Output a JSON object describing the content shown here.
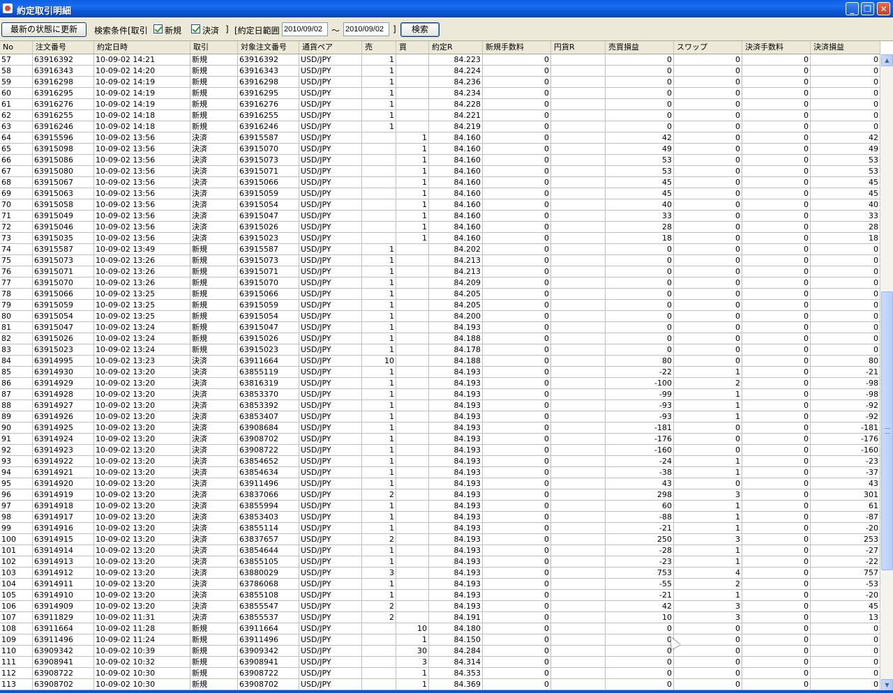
{
  "window": {
    "title": "約定取引明細",
    "min_glyph": "_",
    "max_glyph": "❐",
    "close_glyph": "✕"
  },
  "toolbar": {
    "refresh_label": "最新の状態に更新",
    "condition_label": "検索条件[取引",
    "new_label": "新規",
    "settle_label": "決済",
    "bracket_close": "]",
    "date_range_label": "[約定日範囲",
    "date_from": "2010/09/02",
    "tilde": "～",
    "date_to": "2010/09/02",
    "bracket_close2": "]",
    "search_label": "検索"
  },
  "columns": [
    "No",
    "注文番号",
    "約定日時",
    "取引",
    "対象注文番号",
    "通貨ペア",
    "売",
    "買",
    "約定R",
    "新規手数料",
    "円貨R",
    "売買損益",
    "スワップ",
    "決済手数料",
    "決済損益"
  ],
  "rows": [
    [
      "57",
      "63916392",
      "10-09-02 14:21",
      "新規",
      "63916392",
      "USD/JPY",
      "1",
      "",
      "84.223",
      "0",
      "",
      "0",
      "0",
      "0",
      "0"
    ],
    [
      "58",
      "63916343",
      "10-09-02 14:20",
      "新規",
      "63916343",
      "USD/JPY",
      "1",
      "",
      "84.224",
      "0",
      "",
      "0",
      "0",
      "0",
      "0"
    ],
    [
      "59",
      "63916298",
      "10-09-02 14:19",
      "新規",
      "63916298",
      "USD/JPY",
      "1",
      "",
      "84.236",
      "0",
      "",
      "0",
      "0",
      "0",
      "0"
    ],
    [
      "60",
      "63916295",
      "10-09-02 14:19",
      "新規",
      "63916295",
      "USD/JPY",
      "1",
      "",
      "84.234",
      "0",
      "",
      "0",
      "0",
      "0",
      "0"
    ],
    [
      "61",
      "63916276",
      "10-09-02 14:19",
      "新規",
      "63916276",
      "USD/JPY",
      "1",
      "",
      "84.228",
      "0",
      "",
      "0",
      "0",
      "0",
      "0"
    ],
    [
      "62",
      "63916255",
      "10-09-02 14:18",
      "新規",
      "63916255",
      "USD/JPY",
      "1",
      "",
      "84.221",
      "0",
      "",
      "0",
      "0",
      "0",
      "0"
    ],
    [
      "63",
      "63916246",
      "10-09-02 14:18",
      "新規",
      "63916246",
      "USD/JPY",
      "1",
      "",
      "84.219",
      "0",
      "",
      "0",
      "0",
      "0",
      "0"
    ],
    [
      "64",
      "63915596",
      "10-09-02 13:56",
      "決済",
      "63915587",
      "USD/JPY",
      "",
      "1",
      "84.160",
      "0",
      "",
      "42",
      "0",
      "0",
      "42"
    ],
    [
      "65",
      "63915098",
      "10-09-02 13:56",
      "決済",
      "63915070",
      "USD/JPY",
      "",
      "1",
      "84.160",
      "0",
      "",
      "49",
      "0",
      "0",
      "49"
    ],
    [
      "66",
      "63915086",
      "10-09-02 13:56",
      "決済",
      "63915073",
      "USD/JPY",
      "",
      "1",
      "84.160",
      "0",
      "",
      "53",
      "0",
      "0",
      "53"
    ],
    [
      "67",
      "63915080",
      "10-09-02 13:56",
      "決済",
      "63915071",
      "USD/JPY",
      "",
      "1",
      "84.160",
      "0",
      "",
      "53",
      "0",
      "0",
      "53"
    ],
    [
      "68",
      "63915067",
      "10-09-02 13:56",
      "決済",
      "63915066",
      "USD/JPY",
      "",
      "1",
      "84.160",
      "0",
      "",
      "45",
      "0",
      "0",
      "45"
    ],
    [
      "69",
      "63915063",
      "10-09-02 13:56",
      "決済",
      "63915059",
      "USD/JPY",
      "",
      "1",
      "84.160",
      "0",
      "",
      "45",
      "0",
      "0",
      "45"
    ],
    [
      "70",
      "63915058",
      "10-09-02 13:56",
      "決済",
      "63915054",
      "USD/JPY",
      "",
      "1",
      "84.160",
      "0",
      "",
      "40",
      "0",
      "0",
      "40"
    ],
    [
      "71",
      "63915049",
      "10-09-02 13:56",
      "決済",
      "63915047",
      "USD/JPY",
      "",
      "1",
      "84.160",
      "0",
      "",
      "33",
      "0",
      "0",
      "33"
    ],
    [
      "72",
      "63915046",
      "10-09-02 13:56",
      "決済",
      "63915026",
      "USD/JPY",
      "",
      "1",
      "84.160",
      "0",
      "",
      "28",
      "0",
      "0",
      "28"
    ],
    [
      "73",
      "63915035",
      "10-09-02 13:56",
      "決済",
      "63915023",
      "USD/JPY",
      "",
      "1",
      "84.160",
      "0",
      "",
      "18",
      "0",
      "0",
      "18"
    ],
    [
      "74",
      "63915587",
      "10-09-02 13:49",
      "新規",
      "63915587",
      "USD/JPY",
      "1",
      "",
      "84.202",
      "0",
      "",
      "0",
      "0",
      "0",
      "0"
    ],
    [
      "75",
      "63915073",
      "10-09-02 13:26",
      "新規",
      "63915073",
      "USD/JPY",
      "1",
      "",
      "84.213",
      "0",
      "",
      "0",
      "0",
      "0",
      "0"
    ],
    [
      "76",
      "63915071",
      "10-09-02 13:26",
      "新規",
      "63915071",
      "USD/JPY",
      "1",
      "",
      "84.213",
      "0",
      "",
      "0",
      "0",
      "0",
      "0"
    ],
    [
      "77",
      "63915070",
      "10-09-02 13:26",
      "新規",
      "63915070",
      "USD/JPY",
      "1",
      "",
      "84.209",
      "0",
      "",
      "0",
      "0",
      "0",
      "0"
    ],
    [
      "78",
      "63915066",
      "10-09-02 13:25",
      "新規",
      "63915066",
      "USD/JPY",
      "1",
      "",
      "84.205",
      "0",
      "",
      "0",
      "0",
      "0",
      "0"
    ],
    [
      "79",
      "63915059",
      "10-09-02 13:25",
      "新規",
      "63915059",
      "USD/JPY",
      "1",
      "",
      "84.205",
      "0",
      "",
      "0",
      "0",
      "0",
      "0"
    ],
    [
      "80",
      "63915054",
      "10-09-02 13:25",
      "新規",
      "63915054",
      "USD/JPY",
      "1",
      "",
      "84.200",
      "0",
      "",
      "0",
      "0",
      "0",
      "0"
    ],
    [
      "81",
      "63915047",
      "10-09-02 13:24",
      "新規",
      "63915047",
      "USD/JPY",
      "1",
      "",
      "84.193",
      "0",
      "",
      "0",
      "0",
      "0",
      "0"
    ],
    [
      "82",
      "63915026",
      "10-09-02 13:24",
      "新規",
      "63915026",
      "USD/JPY",
      "1",
      "",
      "84.188",
      "0",
      "",
      "0",
      "0",
      "0",
      "0"
    ],
    [
      "83",
      "63915023",
      "10-09-02 13:24",
      "新規",
      "63915023",
      "USD/JPY",
      "1",
      "",
      "84.178",
      "0",
      "",
      "0",
      "0",
      "0",
      "0"
    ],
    [
      "84",
      "63914995",
      "10-09-02 13:23",
      "決済",
      "63911664",
      "USD/JPY",
      "10",
      "",
      "84.188",
      "0",
      "",
      "80",
      "0",
      "0",
      "80"
    ],
    [
      "85",
      "63914930",
      "10-09-02 13:20",
      "決済",
      "63855119",
      "USD/JPY",
      "1",
      "",
      "84.193",
      "0",
      "",
      "-22",
      "1",
      "0",
      "-21"
    ],
    [
      "86",
      "63914929",
      "10-09-02 13:20",
      "決済",
      "63816319",
      "USD/JPY",
      "1",
      "",
      "84.193",
      "0",
      "",
      "-100",
      "2",
      "0",
      "-98"
    ],
    [
      "87",
      "63914928",
      "10-09-02 13:20",
      "決済",
      "63853370",
      "USD/JPY",
      "1",
      "",
      "84.193",
      "0",
      "",
      "-99",
      "1",
      "0",
      "-98"
    ],
    [
      "88",
      "63914927",
      "10-09-02 13:20",
      "決済",
      "63853392",
      "USD/JPY",
      "1",
      "",
      "84.193",
      "0",
      "",
      "-93",
      "1",
      "0",
      "-92"
    ],
    [
      "89",
      "63914926",
      "10-09-02 13:20",
      "決済",
      "63853407",
      "USD/JPY",
      "1",
      "",
      "84.193",
      "0",
      "",
      "-93",
      "1",
      "0",
      "-92"
    ],
    [
      "90",
      "63914925",
      "10-09-02 13:20",
      "決済",
      "63908684",
      "USD/JPY",
      "1",
      "",
      "84.193",
      "0",
      "",
      "-181",
      "0",
      "0",
      "-181"
    ],
    [
      "91",
      "63914924",
      "10-09-02 13:20",
      "決済",
      "63908702",
      "USD/JPY",
      "1",
      "",
      "84.193",
      "0",
      "",
      "-176",
      "0",
      "0",
      "-176"
    ],
    [
      "92",
      "63914923",
      "10-09-02 13:20",
      "決済",
      "63908722",
      "USD/JPY",
      "1",
      "",
      "84.193",
      "0",
      "",
      "-160",
      "0",
      "0",
      "-160"
    ],
    [
      "93",
      "63914922",
      "10-09-02 13:20",
      "決済",
      "63854652",
      "USD/JPY",
      "1",
      "",
      "84.193",
      "0",
      "",
      "-24",
      "1",
      "0",
      "-23"
    ],
    [
      "94",
      "63914921",
      "10-09-02 13:20",
      "決済",
      "63854634",
      "USD/JPY",
      "1",
      "",
      "84.193",
      "0",
      "",
      "-38",
      "1",
      "0",
      "-37"
    ],
    [
      "95",
      "63914920",
      "10-09-02 13:20",
      "決済",
      "63911496",
      "USD/JPY",
      "1",
      "",
      "84.193",
      "0",
      "",
      "43",
      "0",
      "0",
      "43"
    ],
    [
      "96",
      "63914919",
      "10-09-02 13:20",
      "決済",
      "63837066",
      "USD/JPY",
      "2",
      "",
      "84.193",
      "0",
      "",
      "298",
      "3",
      "0",
      "301"
    ],
    [
      "97",
      "63914918",
      "10-09-02 13:20",
      "決済",
      "63855994",
      "USD/JPY",
      "1",
      "",
      "84.193",
      "0",
      "",
      "60",
      "1",
      "0",
      "61"
    ],
    [
      "98",
      "63914917",
      "10-09-02 13:20",
      "決済",
      "63853403",
      "USD/JPY",
      "1",
      "",
      "84.193",
      "0",
      "",
      "-88",
      "1",
      "0",
      "-87"
    ],
    [
      "99",
      "63914916",
      "10-09-02 13:20",
      "決済",
      "63855114",
      "USD/JPY",
      "1",
      "",
      "84.193",
      "0",
      "",
      "-21",
      "1",
      "0",
      "-20"
    ],
    [
      "100",
      "63914915",
      "10-09-02 13:20",
      "決済",
      "63837657",
      "USD/JPY",
      "2",
      "",
      "84.193",
      "0",
      "",
      "250",
      "3",
      "0",
      "253"
    ],
    [
      "101",
      "63914914",
      "10-09-02 13:20",
      "決済",
      "63854644",
      "USD/JPY",
      "1",
      "",
      "84.193",
      "0",
      "",
      "-28",
      "1",
      "0",
      "-27"
    ],
    [
      "102",
      "63914913",
      "10-09-02 13:20",
      "決済",
      "63855105",
      "USD/JPY",
      "1",
      "",
      "84.193",
      "0",
      "",
      "-23",
      "1",
      "0",
      "-22"
    ],
    [
      "103",
      "63914912",
      "10-09-02 13:20",
      "決済",
      "63880029",
      "USD/JPY",
      "3",
      "",
      "84.193",
      "0",
      "",
      "753",
      "4",
      "0",
      "757"
    ],
    [
      "104",
      "63914911",
      "10-09-02 13:20",
      "決済",
      "63786068",
      "USD/JPY",
      "1",
      "",
      "84.193",
      "0",
      "",
      "-55",
      "2",
      "0",
      "-53"
    ],
    [
      "105",
      "63914910",
      "10-09-02 13:20",
      "決済",
      "63855108",
      "USD/JPY",
      "1",
      "",
      "84.193",
      "0",
      "",
      "-21",
      "1",
      "0",
      "-20"
    ],
    [
      "106",
      "63914909",
      "10-09-02 13:20",
      "決済",
      "63855547",
      "USD/JPY",
      "2",
      "",
      "84.193",
      "0",
      "",
      "42",
      "3",
      "0",
      "45"
    ],
    [
      "107",
      "63911829",
      "10-09-02 11:31",
      "決済",
      "63855537",
      "USD/JPY",
      "2",
      "",
      "84.191",
      "0",
      "",
      "10",
      "3",
      "0",
      "13"
    ],
    [
      "108",
      "63911664",
      "10-09-02 11:28",
      "新規",
      "63911664",
      "USD/JPY",
      "",
      "10",
      "84.180",
      "0",
      "",
      "0",
      "0",
      "0",
      "0"
    ],
    [
      "109",
      "63911496",
      "10-09-02 11:24",
      "新規",
      "63911496",
      "USD/JPY",
      "",
      "1",
      "84.150",
      "0",
      "",
      "0",
      "0",
      "0",
      "0"
    ],
    [
      "110",
      "63909342",
      "10-09-02 10:39",
      "新規",
      "63909342",
      "USD/JPY",
      "",
      "30",
      "84.284",
      "0",
      "",
      "0",
      "0",
      "0",
      "0"
    ],
    [
      "111",
      "63908941",
      "10-09-02 10:32",
      "新規",
      "63908941",
      "USD/JPY",
      "",
      "3",
      "84.314",
      "0",
      "",
      "0",
      "0",
      "0",
      "0"
    ],
    [
      "112",
      "63908722",
      "10-09-02 10:30",
      "新規",
      "63908722",
      "USD/JPY",
      "",
      "1",
      "84.353",
      "0",
      "",
      "0",
      "0",
      "0",
      "0"
    ],
    [
      "113",
      "63908702",
      "10-09-02 10:30",
      "新規",
      "63908702",
      "USD/JPY",
      "",
      "1",
      "84.369",
      "0",
      "",
      "0",
      "0",
      "0",
      "0"
    ]
  ],
  "scrollbar": {
    "up_icon": "arrow-up-icon",
    "down_icon": "arrow-down-icon"
  },
  "colors": {
    "titlebar": "#0a5fe0",
    "window_bg": "#ece9d8",
    "grid_line": "#c0c0c0"
  }
}
